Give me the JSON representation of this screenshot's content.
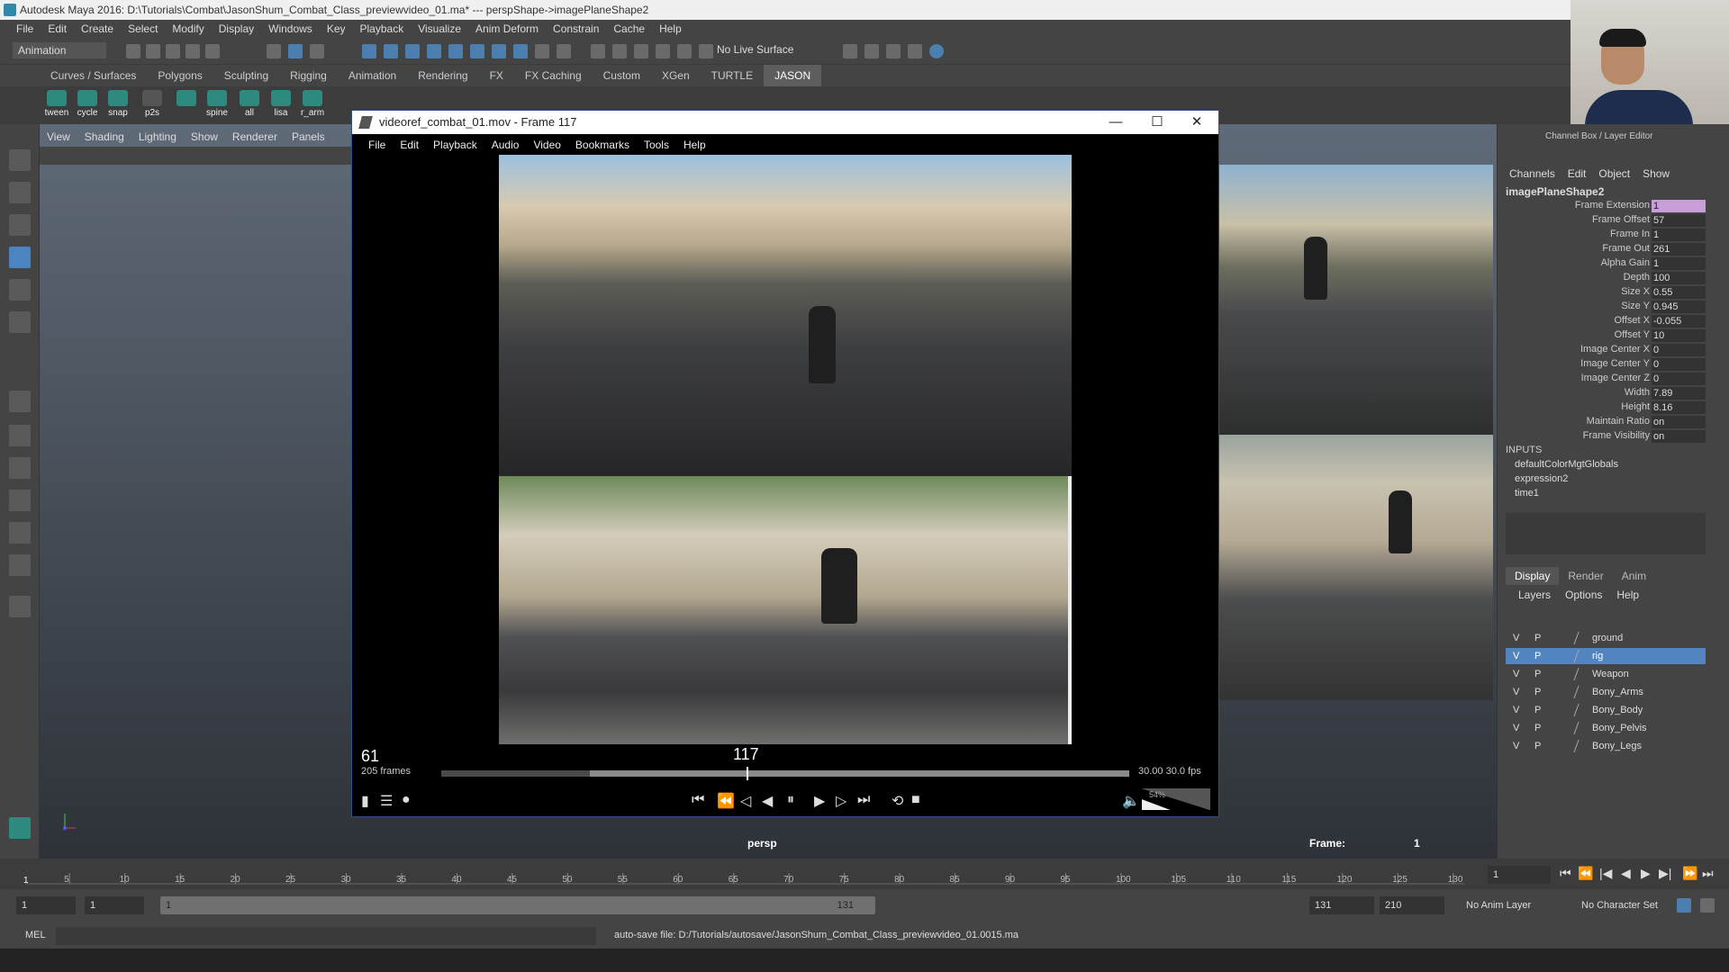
{
  "window": {
    "title": "Autodesk Maya 2016: D:\\Tutorials\\Combat\\JasonShum_Combat_Class_previewvideo_01.ma*  ---  perspShape->imagePlaneShape2"
  },
  "menubar": [
    "File",
    "Edit",
    "Create",
    "Select",
    "Modify",
    "Display",
    "Windows",
    "Key",
    "Playback",
    "Visualize",
    "Anim Deform",
    "Constrain",
    "Cache",
    "Help"
  ],
  "toolbar": {
    "mode": "Animation",
    "live_surface": "No Live Surface"
  },
  "shelf_tabs": [
    "Curves / Surfaces",
    "Polygons",
    "Sculpting",
    "Rigging",
    "Animation",
    "Rendering",
    "FX",
    "FX Caching",
    "Custom",
    "XGen",
    "TURTLE",
    "JASON"
  ],
  "shelf_tab_active": "JASON",
  "shelf_buttons": [
    "tween",
    "cycle",
    "snap",
    "p2s",
    "",
    "spine",
    "all",
    "lisa",
    "r_arm"
  ],
  "viewport": {
    "menu": [
      "View",
      "Shading",
      "Lighting",
      "Show",
      "Renderer",
      "Panels"
    ],
    "camera": "persp",
    "frame_label": "Frame:",
    "frame_value": "1"
  },
  "video_window": {
    "title": "videoref_combat_01.mov - Frame 117",
    "menu": [
      "File",
      "Edit",
      "Playback",
      "Audio",
      "Video",
      "Bookmarks",
      "Tools",
      "Help"
    ],
    "start_frame": "61",
    "frame_count": "205 frames",
    "current_frame": "117",
    "fps_text": "30.00   30.0  fps",
    "volume_pct": "54%",
    "minimize": "—",
    "maximize": "☐",
    "close": "✕"
  },
  "channel_box": {
    "title": "Channel Box / Layer Editor",
    "menu": [
      "Channels",
      "Edit",
      "Object",
      "Show"
    ],
    "node": "imagePlaneShape2",
    "attributes": [
      {
        "name": "Frame Extension",
        "value": "1"
      },
      {
        "name": "Frame Offset",
        "value": "57"
      },
      {
        "name": "Frame In",
        "value": "1"
      },
      {
        "name": "Frame Out",
        "value": "261"
      },
      {
        "name": "Alpha Gain",
        "value": "1"
      },
      {
        "name": "Depth",
        "value": "100"
      },
      {
        "name": "Size X",
        "value": "0.55"
      },
      {
        "name": "Size Y",
        "value": "0.945"
      },
      {
        "name": "Offset X",
        "value": "-0.055"
      },
      {
        "name": "Offset Y",
        "value": "10"
      },
      {
        "name": "Image Center X",
        "value": "0"
      },
      {
        "name": "Image Center Y",
        "value": "0"
      },
      {
        "name": "Image Center Z",
        "value": "0"
      },
      {
        "name": "Width",
        "value": "7.89"
      },
      {
        "name": "Height",
        "value": "8.16"
      },
      {
        "name": "Maintain Ratio",
        "value": "on"
      },
      {
        "name": "Frame Visibility",
        "value": "on"
      }
    ],
    "inputs_label": "INPUTS",
    "inputs": [
      "defaultColorMgtGlobals",
      "expression2",
      "time1"
    ]
  },
  "layer_editor": {
    "tabs": [
      "Display",
      "Render",
      "Anim"
    ],
    "active_tab": "Display",
    "menu": [
      "Layers",
      "Options",
      "Help"
    ],
    "layers": [
      {
        "v": "V",
        "p": "P",
        "name": "ground",
        "selected": false
      },
      {
        "v": "V",
        "p": "P",
        "name": "rig",
        "selected": true
      },
      {
        "v": "V",
        "p": "P",
        "name": "Weapon",
        "selected": false
      },
      {
        "v": "V",
        "p": "P",
        "name": "Bony_Arms",
        "selected": false
      },
      {
        "v": "V",
        "p": "P",
        "name": "Bony_Body",
        "selected": false
      },
      {
        "v": "V",
        "p": "P",
        "name": "Bony_Pelvis",
        "selected": false
      },
      {
        "v": "V",
        "p": "P",
        "name": "Bony_Legs",
        "selected": false
      }
    ]
  },
  "timeline": {
    "ticks": [
      "5",
      "10",
      "15",
      "20",
      "25",
      "30",
      "35",
      "40",
      "45",
      "50",
      "55",
      "60",
      "65",
      "70",
      "75",
      "80",
      "85",
      "90",
      "95",
      "100",
      "105",
      "110",
      "115",
      "120",
      "125",
      "130"
    ],
    "start_marker": "1",
    "current_frame_field": "1"
  },
  "range": {
    "start": "1",
    "anim_start": "1",
    "slider_start": "1",
    "slider_end": "131",
    "end": "131",
    "anim_end": "210",
    "anim_layer": "No Anim Layer",
    "character_set": "No Character Set"
  },
  "command_line": {
    "mode": "MEL",
    "message": "auto-save file: D:/Tutorials/autosave/JasonShum_Combat_Class_previewvideo_01.0015.ma"
  },
  "colors": {
    "accent": "#5285c0",
    "maya_bg": "#444444",
    "highlight_attr": "#c89ed8",
    "shelf_icon": "#2e8a7e"
  }
}
